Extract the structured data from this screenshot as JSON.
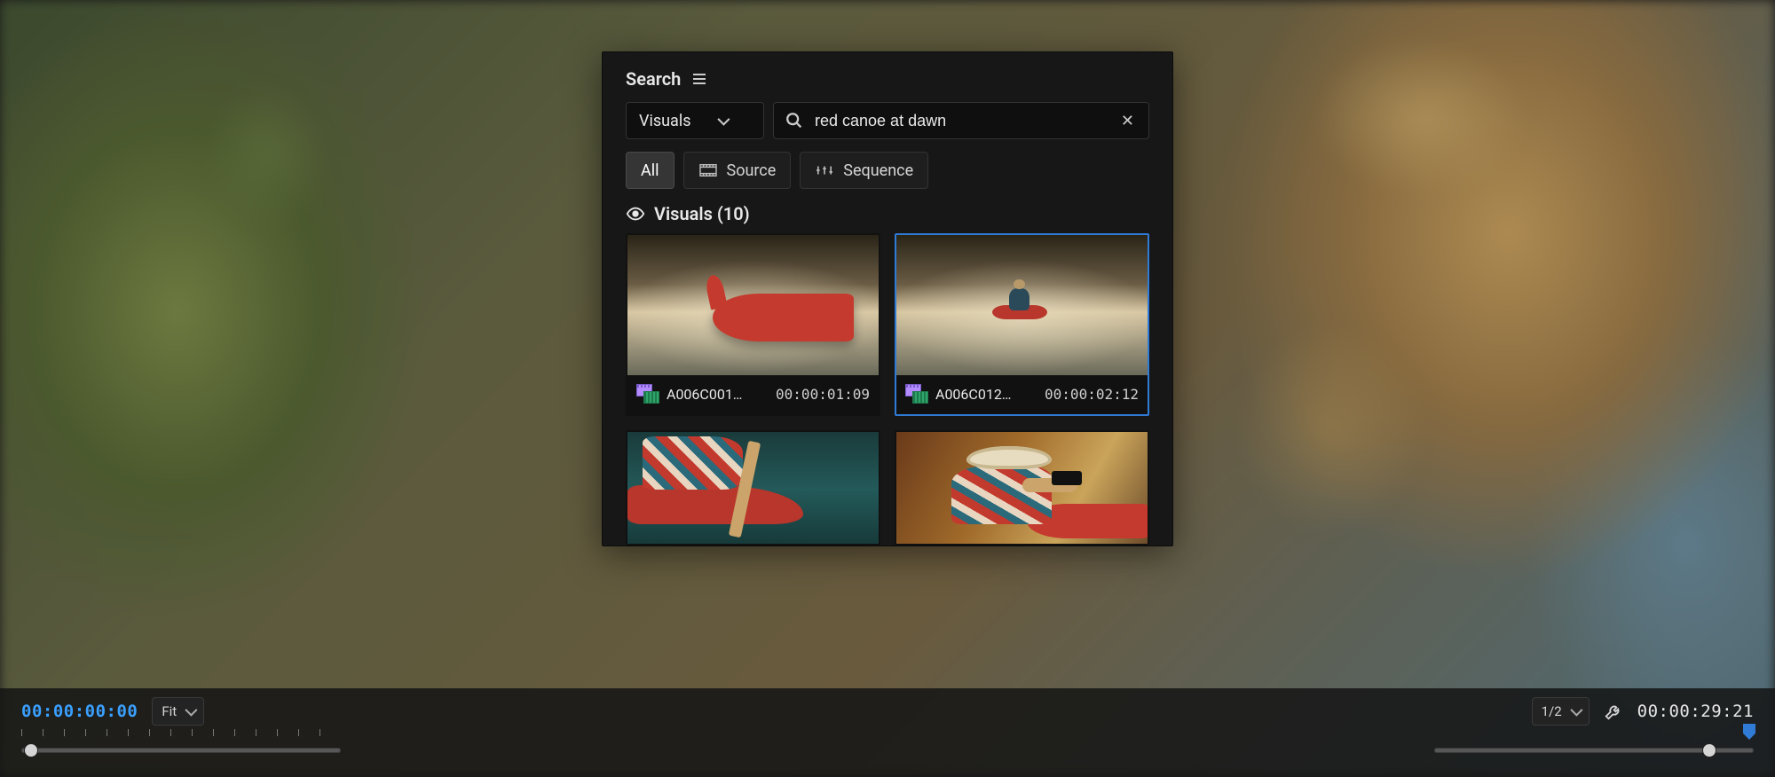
{
  "panel": {
    "title": "Search",
    "scope_selected": "Visuals",
    "query": "red canoe at dawn",
    "filters": {
      "all": "All",
      "source": "Source",
      "sequence": "Sequence"
    },
    "results_heading": "Visuals (10)"
  },
  "results": [
    {
      "name": "A006C001…",
      "duration": "00:00:01:09",
      "selected": false
    },
    {
      "name": "A006C012…",
      "duration": "00:00:02:12",
      "selected": true
    },
    {
      "name": "",
      "duration": "",
      "selected": false
    },
    {
      "name": "",
      "duration": "",
      "selected": false
    }
  ],
  "player": {
    "in_timecode": "00:00:00:00",
    "zoom_label": "Fit",
    "resolution_label": "1/2",
    "out_timecode": "00:00:29:21"
  }
}
